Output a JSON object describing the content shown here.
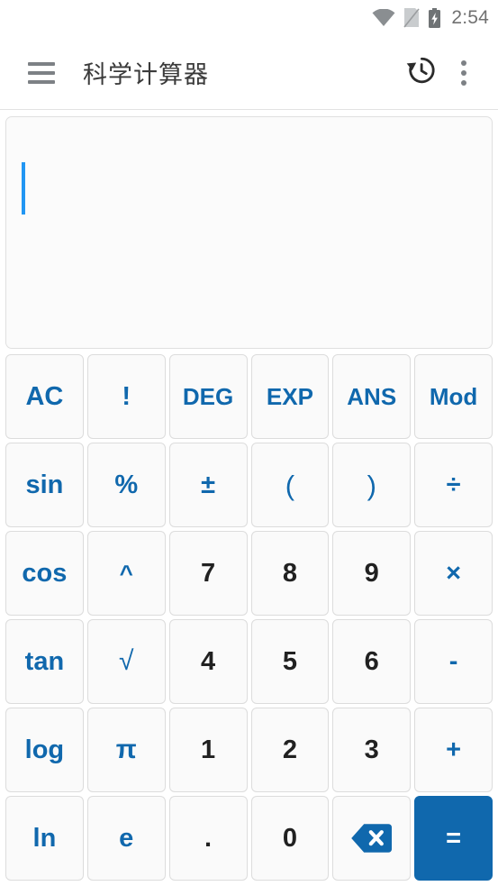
{
  "status_bar": {
    "time": "2:54",
    "icons": [
      "wifi-icon",
      "no-sim-icon",
      "battery-charging-icon"
    ]
  },
  "app_bar": {
    "menu_icon": "hamburger-menu-icon",
    "title": "科学计算器",
    "history_icon": "history-icon",
    "overflow_icon": "overflow-menu-icon"
  },
  "display": {
    "expression": "",
    "placeholder": "",
    "cursor_visible": true
  },
  "colors": {
    "accent": "#1068ad",
    "cursor": "#2196f3",
    "key_bg": "#fafafa",
    "key_border": "#dcdcdc",
    "digit_text": "#212121"
  },
  "keypad": {
    "rows": [
      [
        {
          "label": "AC",
          "name": "key-ac",
          "kind": "func"
        },
        {
          "label": "!",
          "name": "key-factorial",
          "kind": "func"
        },
        {
          "label": "DEG",
          "name": "key-deg",
          "kind": "func"
        },
        {
          "label": "EXP",
          "name": "key-exp",
          "kind": "func"
        },
        {
          "label": "ANS",
          "name": "key-ans",
          "kind": "func"
        },
        {
          "label": "Mod",
          "name": "key-mod",
          "kind": "func"
        }
      ],
      [
        {
          "label": "sin",
          "name": "key-sin",
          "kind": "func"
        },
        {
          "label": "%",
          "name": "key-percent",
          "kind": "func"
        },
        {
          "label": "±",
          "name": "key-plus-minus",
          "kind": "func"
        },
        {
          "label": "(",
          "name": "key-open-paren",
          "kind": "func"
        },
        {
          "label": ")",
          "name": "key-close-paren",
          "kind": "func"
        },
        {
          "label": "÷",
          "name": "key-divide",
          "kind": "func"
        }
      ],
      [
        {
          "label": "cos",
          "name": "key-cos",
          "kind": "func"
        },
        {
          "label": "^",
          "name": "key-power",
          "kind": "func"
        },
        {
          "label": "7",
          "name": "key-7",
          "kind": "digit"
        },
        {
          "label": "8",
          "name": "key-8",
          "kind": "digit"
        },
        {
          "label": "9",
          "name": "key-9",
          "kind": "digit"
        },
        {
          "label": "×",
          "name": "key-multiply",
          "kind": "func"
        }
      ],
      [
        {
          "label": "tan",
          "name": "key-tan",
          "kind": "func"
        },
        {
          "label": "√",
          "name": "key-sqrt",
          "kind": "func"
        },
        {
          "label": "4",
          "name": "key-4",
          "kind": "digit"
        },
        {
          "label": "5",
          "name": "key-5",
          "kind": "digit"
        },
        {
          "label": "6",
          "name": "key-6",
          "kind": "digit"
        },
        {
          "label": "-",
          "name": "key-minus",
          "kind": "func"
        }
      ],
      [
        {
          "label": "log",
          "name": "key-log",
          "kind": "func"
        },
        {
          "label": "π",
          "name": "key-pi",
          "kind": "func"
        },
        {
          "label": "1",
          "name": "key-1",
          "kind": "digit"
        },
        {
          "label": "2",
          "name": "key-2",
          "kind": "digit"
        },
        {
          "label": "3",
          "name": "key-3",
          "kind": "digit"
        },
        {
          "label": "+",
          "name": "key-plus",
          "kind": "func"
        }
      ],
      [
        {
          "label": "ln",
          "name": "key-ln",
          "kind": "func"
        },
        {
          "label": "e",
          "name": "key-e",
          "kind": "func"
        },
        {
          "label": ".",
          "name": "key-decimal",
          "kind": "digit"
        },
        {
          "label": "0",
          "name": "key-0",
          "kind": "digit"
        },
        {
          "label": "",
          "name": "key-backspace",
          "kind": "backspace",
          "icon": "backspace-icon"
        },
        {
          "label": "=",
          "name": "key-equals",
          "kind": "equals"
        }
      ]
    ]
  }
}
